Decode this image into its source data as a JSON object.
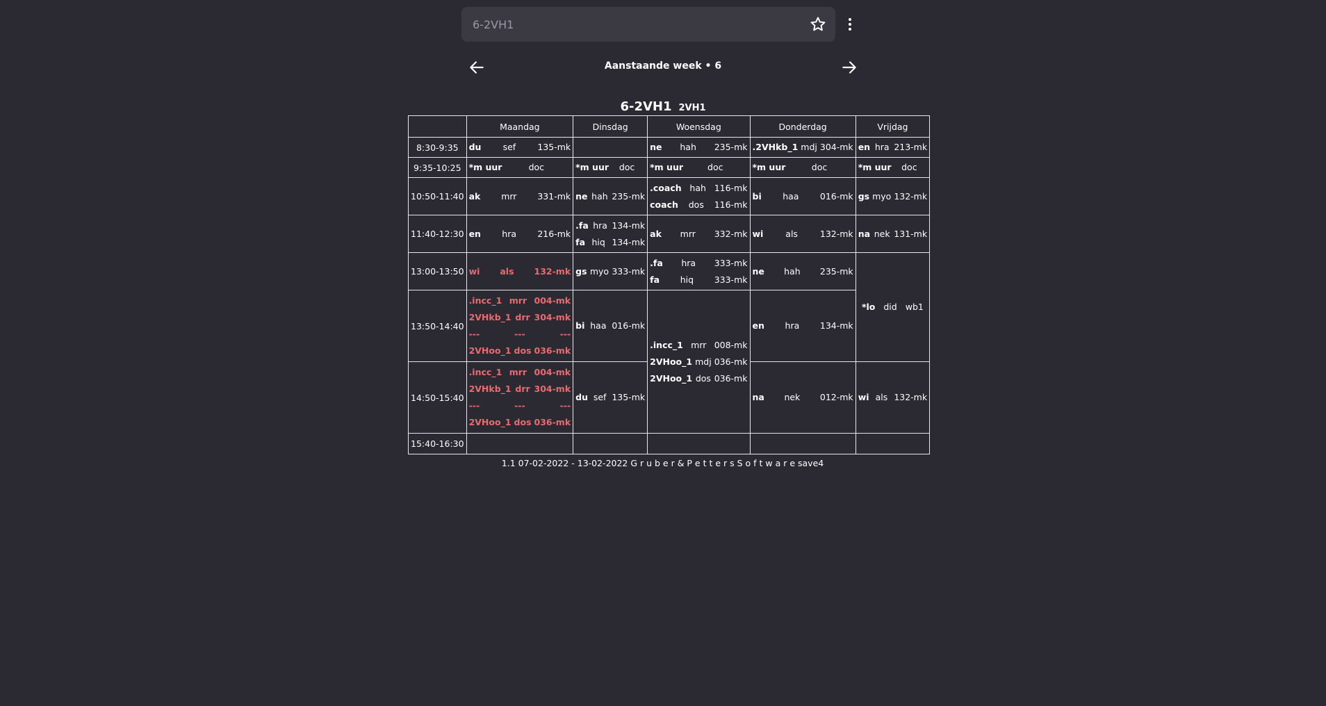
{
  "search": {
    "placeholder": "6-2VH1",
    "value": ""
  },
  "nav": {
    "week_label": "Aanstaande week • 6"
  },
  "schedule": {
    "title": "6-2VH1",
    "subtitle": "2VH1",
    "days": [
      "Maandag",
      "Dinsdag",
      "Woensdag",
      "Donderdag",
      "Vrijdag"
    ],
    "times": [
      "8:30-9:35",
      "9:35-10:25",
      "10:50-11:40",
      "11:40-12:30",
      "13:00-13:50",
      "13:50-14:40",
      "14:50-15:40",
      "15:40-16:30"
    ],
    "cells": {
      "r0_mon": [
        {
          "s": "du",
          "t": "sef",
          "r": "135-mk"
        }
      ],
      "r0_wed": [
        {
          "s": "ne",
          "t": "hah",
          "r": "235-mk"
        }
      ],
      "r0_thu": [
        {
          "s": ".2VHkb_1",
          "t": "mdj",
          "r": "304-mk"
        }
      ],
      "r0_fri": [
        {
          "s": "en",
          "t": "hra",
          "r": "213-mk"
        }
      ],
      "r1_mon": [
        {
          "s": "*m uur",
          "t": "doc",
          "r": ""
        }
      ],
      "r1_tue": [
        {
          "s": "*m uur",
          "t": "doc",
          "r": ""
        }
      ],
      "r1_wed": [
        {
          "s": "*m uur",
          "t": "doc",
          "r": ""
        }
      ],
      "r1_thu": [
        {
          "s": "*m uur",
          "t": "doc",
          "r": ""
        }
      ],
      "r1_fri": [
        {
          "s": "*m uur",
          "t": "doc",
          "r": ""
        }
      ],
      "r2_mon": [
        {
          "s": "ak",
          "t": "mrr",
          "r": "331-mk"
        }
      ],
      "r2_tue": [
        {
          "s": "ne",
          "t": "hah",
          "r": "235-mk"
        }
      ],
      "r2_wed": [
        {
          "s": ".coach",
          "t": "hah",
          "r": "116-mk"
        },
        {
          "s": "coach",
          "t": "dos",
          "r": "116-mk"
        }
      ],
      "r2_thu": [
        {
          "s": "bi",
          "t": "haa",
          "r": "016-mk"
        }
      ],
      "r2_fri": [
        {
          "s": "gs",
          "t": "myo",
          "r": "132-mk"
        }
      ],
      "r3_mon": [
        {
          "s": "en",
          "t": "hra",
          "r": "216-mk"
        }
      ],
      "r3_tue": [
        {
          "s": ".fa",
          "t": "hra",
          "r": "134-mk"
        },
        {
          "s": "fa",
          "t": "hiq",
          "r": "134-mk"
        }
      ],
      "r3_wed": [
        {
          "s": "ak",
          "t": "mrr",
          "r": "332-mk"
        }
      ],
      "r3_thu": [
        {
          "s": "wi",
          "t": "als",
          "r": "132-mk"
        }
      ],
      "r3_fri": [
        {
          "s": "na",
          "t": "nek",
          "r": "131-mk"
        }
      ],
      "r4_mon": [
        {
          "s": "wi",
          "t": "als",
          "r": "132-mk"
        }
      ],
      "r4_tue": [
        {
          "s": "gs",
          "t": "myo",
          "r": "333-mk"
        }
      ],
      "r4_wed": [
        {
          "s": ".fa",
          "t": "hra",
          "r": "333-mk"
        },
        {
          "s": "fa",
          "t": "hiq",
          "r": "333-mk"
        }
      ],
      "r4_thu": [
        {
          "s": "ne",
          "t": "hah",
          "r": "235-mk"
        }
      ],
      "r4_fri": [
        {
          "s": "*lo",
          "t": "did",
          "r": "wb1"
        }
      ],
      "r5_mon": [
        {
          "s": ".incc_1",
          "t": "mrr",
          "r": "004-mk"
        },
        {
          "s": "2VHkb_1",
          "t": "drr",
          "r": "304-mk"
        },
        {
          "s": "---",
          "t": "---",
          "r": "---"
        },
        {
          "s": "2VHoo_1",
          "t": "dos",
          "r": "036-mk"
        }
      ],
      "r5_tue": [
        {
          "s": "bi",
          "t": "haa",
          "r": "016-mk"
        }
      ],
      "r5_wed": [
        {
          "s": ".incc_1",
          "t": "mrr",
          "r": "008-mk"
        },
        {
          "s": "2VHoo_1",
          "t": "mdj",
          "r": "036-mk"
        },
        {
          "s": "2VHoo_1",
          "t": "dos",
          "r": "036-mk"
        }
      ],
      "r5_thu": [
        {
          "s": "en",
          "t": "hra",
          "r": "134-mk"
        }
      ],
      "r6_mon": [
        {
          "s": ".incc_1",
          "t": "mrr",
          "r": "004-mk"
        },
        {
          "s": "2VHkb_1",
          "t": "drr",
          "r": "304-mk"
        },
        {
          "s": "---",
          "t": "---",
          "r": "---"
        },
        {
          "s": "2VHoo_1",
          "t": "dos",
          "r": "036-mk"
        }
      ],
      "r6_tue": [
        {
          "s": "du",
          "t": "sef",
          "r": "135-mk"
        }
      ],
      "r6_thu": [
        {
          "s": "na",
          "t": "nek",
          "r": "012-mk"
        }
      ],
      "r6_fri": [
        {
          "s": "wi",
          "t": "als",
          "r": "132-mk"
        }
      ]
    },
    "highlighted_cells": [
      "r4_mon",
      "r5_mon",
      "r6_mon"
    ],
    "highlight_color": "#e86b70"
  },
  "footer": {
    "text": "1.1 07-02-2022 - 13-02-2022 G r u b e r & P e t t e r s S o f t w a r e save4"
  },
  "icons": {
    "star": "star-icon",
    "menu": "more-vert-icon",
    "prev": "arrow-left-icon",
    "next": "arrow-right-icon"
  }
}
